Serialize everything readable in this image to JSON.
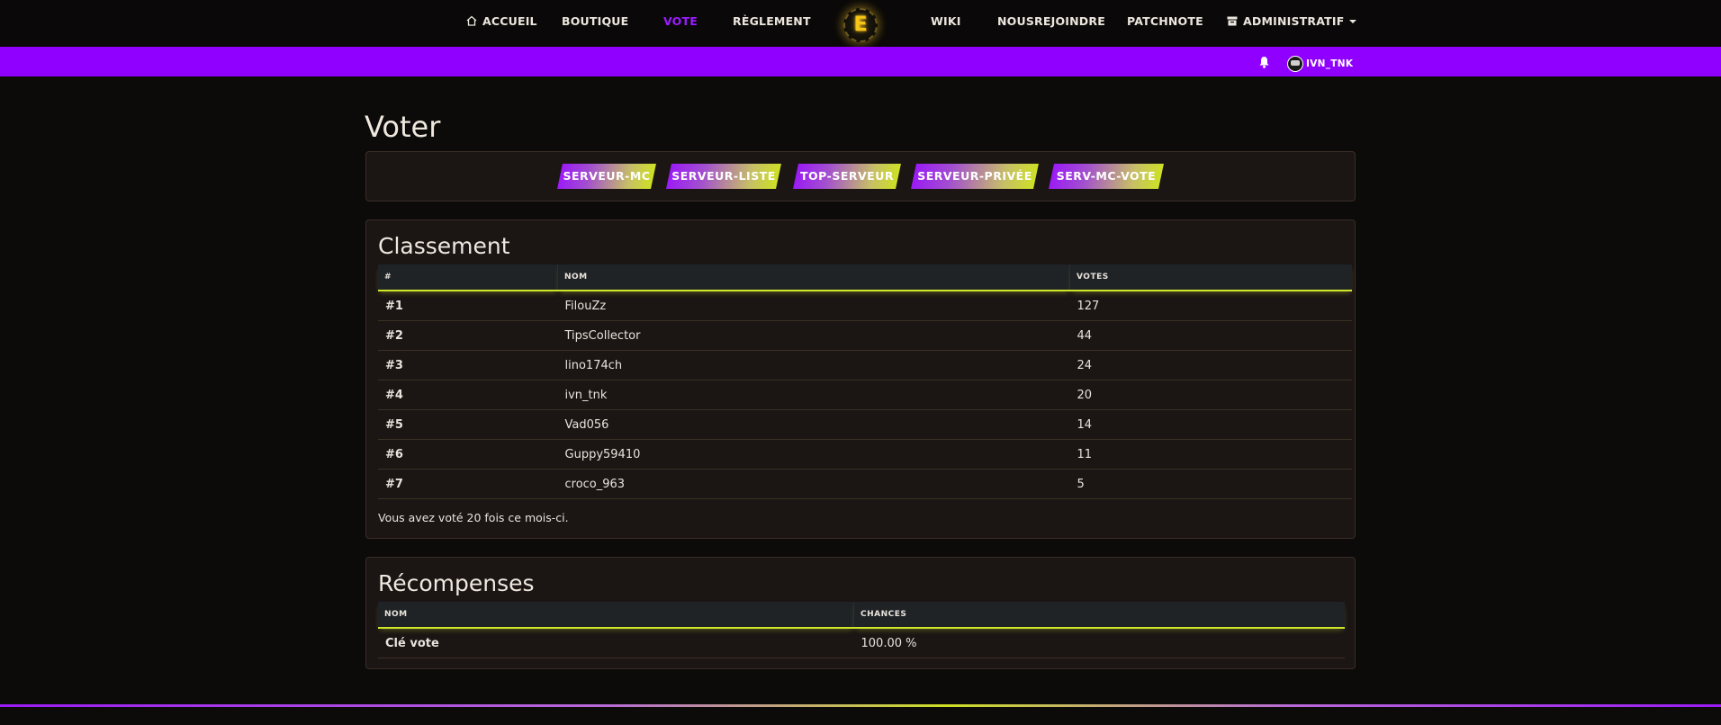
{
  "nav": {
    "accueil": "ACCUEIL",
    "boutique": "BOUTIQUE",
    "vote": "VOTE",
    "reglement": "RÈGLEMENT",
    "logo_letter": "E",
    "wiki": "WIKI",
    "nousrejoindre": "NOUSREJOINDRE",
    "patchnote": "PATCHNOTE",
    "administratif": "ADMINISTRATIF"
  },
  "user": {
    "name": "IVN_TNK"
  },
  "page_title": "Voter",
  "vote_sites": [
    "SERVEUR-MC",
    "SERVEUR-LISTE",
    "TOP-SERVEUR",
    "SERVEUR-PRIVÉE",
    "SERV-MC-VOTE"
  ],
  "classement": {
    "title": "Classement",
    "headers": {
      "rank": "#",
      "name": "NOM",
      "votes": "VOTES"
    },
    "rows": [
      {
        "rank": "#1",
        "name": "FilouZz",
        "votes": "127"
      },
      {
        "rank": "#2",
        "name": "TipsCollector",
        "votes": "44"
      },
      {
        "rank": "#3",
        "name": "lino174ch",
        "votes": "24"
      },
      {
        "rank": "#4",
        "name": "ivn_tnk",
        "votes": "20"
      },
      {
        "rank": "#5",
        "name": "Vad056",
        "votes": "14"
      },
      {
        "rank": "#6",
        "name": "Guppy59410",
        "votes": "11"
      },
      {
        "rank": "#7",
        "name": "croco_963",
        "votes": "5"
      }
    ],
    "note": "Vous avez voté 20 fois ce mois-ci."
  },
  "recompenses": {
    "title": "Récompenses",
    "headers": {
      "name": "NOM",
      "chances": "CHANCES"
    },
    "rows": [
      {
        "name": "Clé vote",
        "chances": "100.00 %"
      }
    ]
  },
  "colors": {
    "accent": "#8f00ff",
    "lime": "#cde025",
    "background": "#0d0a0a",
    "card": "#1b1514"
  },
  "icons": {
    "home": "home-icon",
    "bell": "bell-icon",
    "archive": "archive-icon",
    "logo": "server-logo"
  }
}
